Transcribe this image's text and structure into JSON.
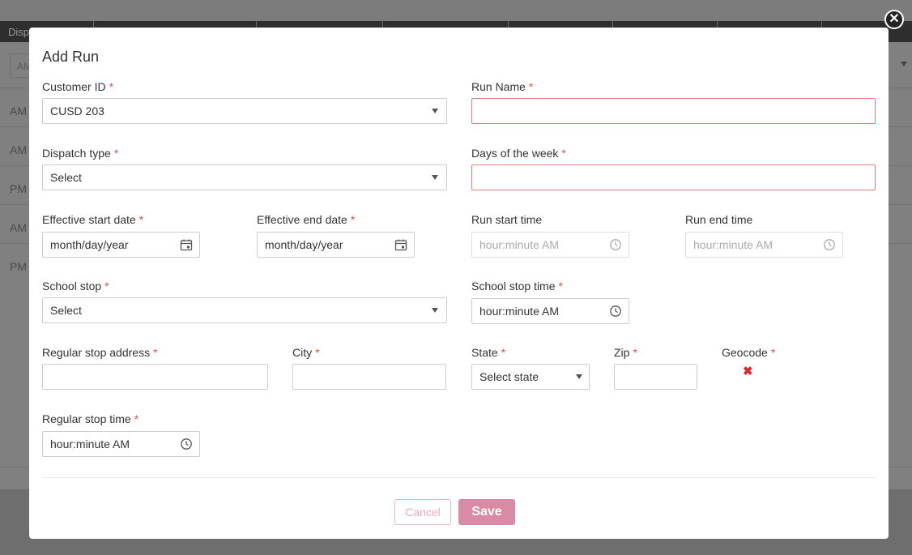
{
  "background": {
    "header_label": "Dispa",
    "rows": [
      "AM",
      "AM",
      "PM",
      "AM",
      "PM"
    ],
    "select_text": "AM"
  },
  "modal": {
    "title": "Add Run",
    "close_glyph": "✕",
    "required_mark": "*",
    "fields": {
      "customer_id": {
        "label": "Customer ID",
        "value": "CUSD 203"
      },
      "run_name": {
        "label": "Run Name",
        "value": ""
      },
      "dispatch_type": {
        "label": "Dispatch type",
        "value": "Select"
      },
      "days_of_week": {
        "label": "Days of the week",
        "value": ""
      },
      "effective_start_date": {
        "label": "Effective start date",
        "placeholder": "month/day/year"
      },
      "effective_end_date": {
        "label": "Effective end date",
        "placeholder": "month/day/year"
      },
      "run_start_time": {
        "label": "Run start time",
        "placeholder": "hour:minute AM"
      },
      "run_end_time": {
        "label": "Run end time",
        "placeholder": "hour:minute AM"
      },
      "school_stop": {
        "label": "School stop",
        "value": "Select"
      },
      "school_stop_time": {
        "label": "School stop time",
        "placeholder": "hour:minute AM"
      },
      "regular_stop_address": {
        "label": "Regular stop address",
        "value": ""
      },
      "city": {
        "label": "City",
        "value": ""
      },
      "state": {
        "label": "State",
        "value": "Select state"
      },
      "zip": {
        "label": "Zip",
        "value": ""
      },
      "geocode": {
        "label": "Geocode",
        "status_glyph": "✖"
      },
      "regular_stop_time": {
        "label": "Regular stop time",
        "placeholder": "hour:minute AM"
      }
    },
    "buttons": {
      "cancel": "Cancel",
      "save": "Save"
    }
  },
  "colors": {
    "required": "#d9534f",
    "error_border": "#e07b7b",
    "save_bg": "#d98ba5",
    "geocode_x": "#d9282f"
  }
}
